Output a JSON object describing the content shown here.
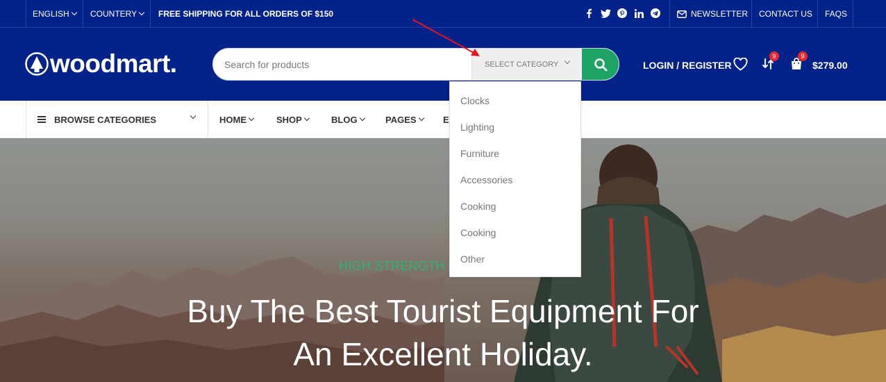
{
  "topbar": {
    "language": "ENGLISH",
    "country": "COUNTERY",
    "promo": "FREE SHIPPING FOR ALL ORDERS OF $150",
    "social_icons": [
      "facebook-icon",
      "twitter-icon",
      "pinterest-icon",
      "linkedin-icon",
      "telegram-icon"
    ],
    "newsletter": "NEWSLETTER",
    "contact": "CONTACT US",
    "faqs": "FAQS"
  },
  "header": {
    "logo_text": "woodmart.",
    "search": {
      "placeholder": "Search for products",
      "category_label": "SELECT CATEGORY"
    },
    "login": "LOGIN / REGISTER",
    "compare_count": "9",
    "cart_count": "9",
    "cart_total": "$279.00"
  },
  "category_dropdown": {
    "options": [
      "Clocks",
      "Lighting",
      "Furniture",
      "Accessories",
      "Cooking",
      "Cooking",
      "Other"
    ]
  },
  "nav": {
    "browse": "BROWSE CATEGORIES",
    "items": [
      "HOME",
      "SHOP",
      "BLOG",
      "PAGES",
      "E"
    ]
  },
  "hero": {
    "subtitle": "HIGH STRENGTH A",
    "title_line1": "Buy The Best Tourist Equipment For",
    "title_line2": "An Excellent Holiday."
  },
  "colors": {
    "primary": "#03228a",
    "accent": "#1fa365",
    "badge": "#e42a30"
  }
}
